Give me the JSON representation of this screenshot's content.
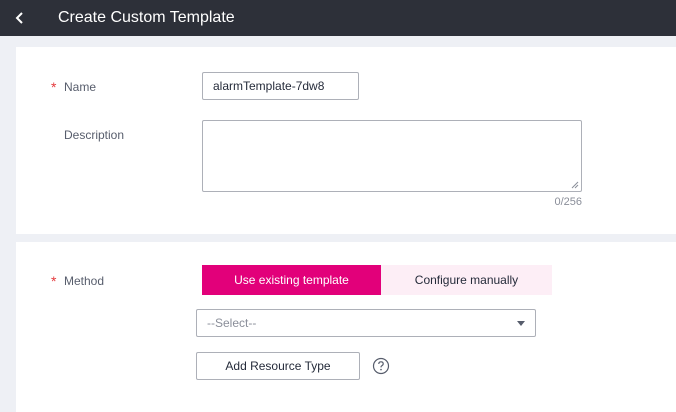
{
  "header": {
    "title": "Create Custom Template",
    "back_icon": "chevron-left-icon"
  },
  "form": {
    "required_mark": "*",
    "name_label": "Name",
    "name_value": "alarmTemplate-7dw8",
    "description_label": "Description",
    "description_value": "",
    "description_counter": "0/256",
    "method_label": "Method",
    "method_options": [
      "Use existing template",
      "Configure manually"
    ],
    "method_selected": "Use existing template",
    "template_select_value": "--Select--",
    "add_resource_type_label": "Add Resource Type",
    "help_icon": "question-circle-icon"
  },
  "colors": {
    "header_bg": "#2d3039",
    "accent": "#e2007a",
    "accent_light": "#fdeef6",
    "required": "#e4393c"
  }
}
